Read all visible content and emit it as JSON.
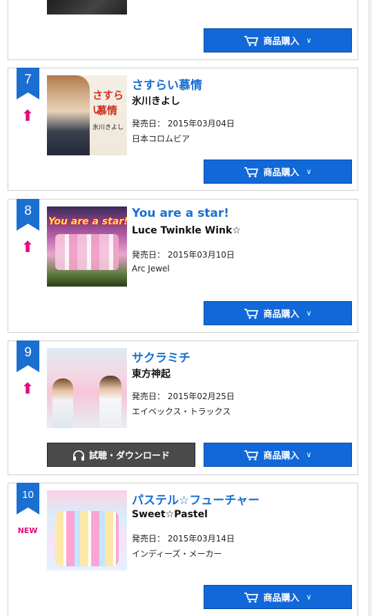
{
  "buy_label": "商品購入",
  "download_label": "試聴・ダウンロード",
  "release_prefix": "発売日：",
  "colors": {
    "accent": "#1a6fd1",
    "trend": "#e5097f",
    "button": "#1168d8",
    "dark_button": "#4a4a4a"
  },
  "items": [
    {
      "rank": "7",
      "trend": "up-arrow-icon",
      "title": "さすらい慕情",
      "artist": "氷川きよし",
      "release": "発売日：  2015年03月04日",
      "label": "日本コロムビア",
      "jacket_text": [
        "さすらい",
        "慕情",
        "氷川きよし"
      ]
    },
    {
      "rank": "8",
      "trend": "up-arrow-icon",
      "title": "You are a star!",
      "artist": "Luce Twinkle Wink☆",
      "release": "発売日：  2015年03月10日",
      "label": "Arc Jewel",
      "jacket_text": [
        "You are a star!"
      ]
    },
    {
      "rank": "9",
      "trend": "up-arrow-icon",
      "title": "サクラミチ",
      "artist": "東方神起",
      "release": "発売日：  2015年02月25日",
      "label": "エイベックス・トラックス",
      "jacket_text": []
    },
    {
      "rank": "10",
      "trend": "NEW",
      "title": "パステル☆フューチャー",
      "artist": "Sweet☆Pastel",
      "release": "発売日：  2015年03月14日",
      "label": "インディーズ・メーカー",
      "jacket_text": []
    }
  ]
}
